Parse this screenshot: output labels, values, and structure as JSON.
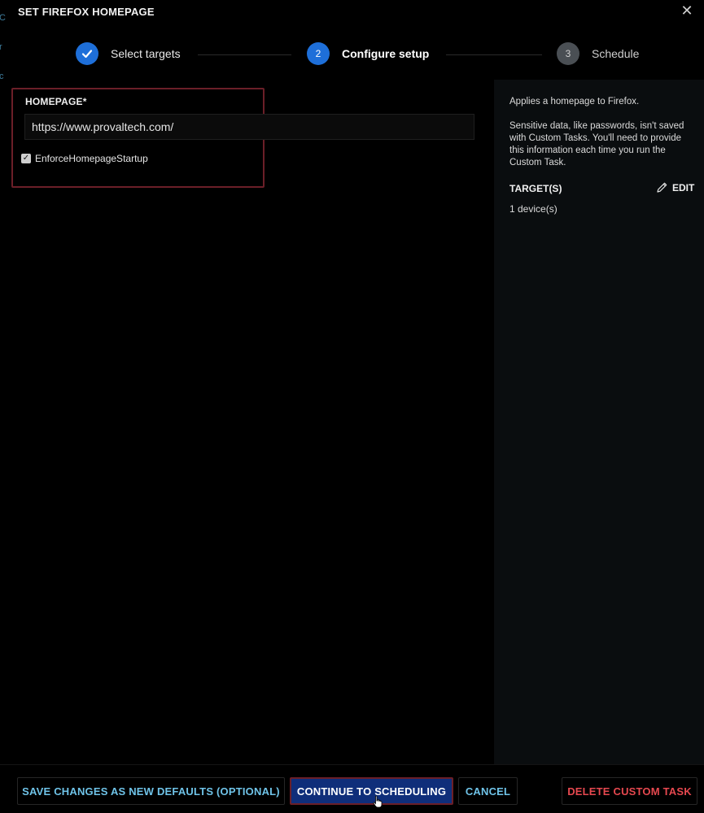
{
  "dialog": {
    "title": "SET FIREFOX HOMEPAGE"
  },
  "stepper": {
    "steps": [
      {
        "number": "✓",
        "label": "Select targets",
        "state": "complete"
      },
      {
        "number": "2",
        "label": "Configure setup",
        "state": "active"
      },
      {
        "number": "3",
        "label": "Schedule",
        "state": "pending"
      }
    ]
  },
  "form": {
    "homepage_label": "HOMEPAGE*",
    "homepage_value": "https://www.provaltech.com/",
    "enforce_label": "EnforceHomepageStartup",
    "enforce_checked": true
  },
  "info": {
    "description": "Applies a homepage to Firefox.",
    "sensitive_note": "Sensitive data, like passwords, isn't saved with Custom Tasks. You'll need to provide this information each time you run the Custom Task.",
    "targets_label": "TARGET(S)",
    "edit_label": "EDIT",
    "targets_value": "1 device(s)"
  },
  "footer": {
    "save_defaults_label": "SAVE CHANGES AS NEW DEFAULTS (OPTIONAL)",
    "continue_label": "CONTINUE TO SCHEDULING",
    "cancel_label": "CANCEL",
    "delete_label": "DELETE CUSTOM TASK"
  },
  "colors": {
    "accent": "#1e6fd9",
    "link": "#6fc3e8",
    "danger": "#e6484f",
    "highlight": "#6b1f28"
  }
}
